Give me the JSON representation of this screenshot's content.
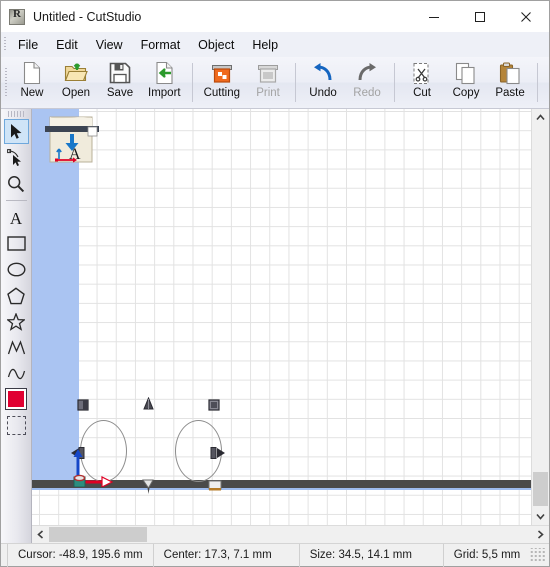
{
  "window": {
    "title": "Untitled - CutStudio",
    "app_icon": "roland-logo-icon",
    "minimize_label": "—",
    "maximize_label": "□",
    "close_label": "✕"
  },
  "menubar": {
    "items": [
      {
        "label": "File",
        "name": "menu-file"
      },
      {
        "label": "Edit",
        "name": "menu-edit"
      },
      {
        "label": "View",
        "name": "menu-view"
      },
      {
        "label": "Format",
        "name": "menu-format"
      },
      {
        "label": "Object",
        "name": "menu-object"
      },
      {
        "label": "Help",
        "name": "menu-help"
      }
    ]
  },
  "toolbar": {
    "groups": [
      {
        "buttons": [
          {
            "label": "New",
            "icon": "new-document-icon",
            "enabled": true
          },
          {
            "label": "Open",
            "icon": "open-folder-icon",
            "enabled": true
          },
          {
            "label": "Save",
            "icon": "floppy-disk-icon",
            "enabled": true
          },
          {
            "label": "Import",
            "icon": "import-arrow-icon",
            "enabled": true
          }
        ]
      },
      {
        "buttons": [
          {
            "label": "Cutting",
            "icon": "cutting-plotter-icon",
            "enabled": true
          },
          {
            "label": "Print",
            "icon": "printer-icon",
            "enabled": false
          }
        ]
      },
      {
        "buttons": [
          {
            "label": "Undo",
            "icon": "undo-arrow-icon",
            "enabled": true
          },
          {
            "label": "Redo",
            "icon": "redo-arrow-icon",
            "enabled": false
          }
        ]
      },
      {
        "buttons": [
          {
            "label": "Cut",
            "icon": "scissors-icon",
            "enabled": true
          },
          {
            "label": "Copy",
            "icon": "copy-pages-icon",
            "enabled": true
          },
          {
            "label": "Paste",
            "icon": "clipboard-paste-icon",
            "enabled": true
          }
        ]
      }
    ]
  },
  "tool_palette": {
    "tools": [
      {
        "name": "select-tool",
        "icon": "arrow-pointer-icon",
        "active": true
      },
      {
        "name": "node-edit-tool",
        "icon": "node-edit-arrow-icon",
        "active": false
      },
      {
        "name": "zoom-tool",
        "icon": "magnifier-icon",
        "active": false
      },
      {
        "name": "text-tool",
        "icon": "text-a-icon",
        "active": false
      },
      {
        "name": "rectangle-tool",
        "icon": "rectangle-icon",
        "active": false
      },
      {
        "name": "ellipse-tool",
        "icon": "ellipse-icon",
        "active": false
      },
      {
        "name": "polygon-tool",
        "icon": "pentagon-icon",
        "active": false
      },
      {
        "name": "star-tool",
        "icon": "star-icon",
        "active": false
      },
      {
        "name": "polyline-tool",
        "icon": "polyline-icon",
        "active": false
      },
      {
        "name": "curve-tool",
        "icon": "curve-icon",
        "active": false
      },
      {
        "name": "fill-color-swatch",
        "icon": "color-swatch-icon",
        "active": false
      },
      {
        "name": "no-fill-swatch",
        "icon": "no-fill-icon",
        "active": false
      }
    ],
    "fill_color": "#e00032"
  },
  "canvas": {
    "media_color": "#aac4f2",
    "grid_color": "#e2e2e2",
    "media_bar_color": "#4a4a4a",
    "object_outline_color": "#8d8d8d",
    "objects": [
      {
        "name": "ellipse-object-left",
        "shape": "ellipse"
      },
      {
        "name": "ellipse-object-right",
        "shape": "ellipse"
      }
    ],
    "markers": [
      {
        "name": "pinch-roller-marker-left"
      },
      {
        "name": "pinch-roller-marker-middle"
      },
      {
        "name": "pinch-roller-marker-right"
      },
      {
        "name": "origin-axis-marker"
      }
    ]
  },
  "scrollbars": {
    "h_left_arrow": "‹",
    "h_right_arrow": "›",
    "v_up_arrow": "˄",
    "v_down_arrow": "˅"
  },
  "statusbar": {
    "cursor": "Cursor: -48.9, 195.6 mm",
    "center": "Center: 17.3, 7.1 mm",
    "size": "Size: 34.5, 14.1 mm",
    "grid": "Grid: 5,5 mm"
  }
}
